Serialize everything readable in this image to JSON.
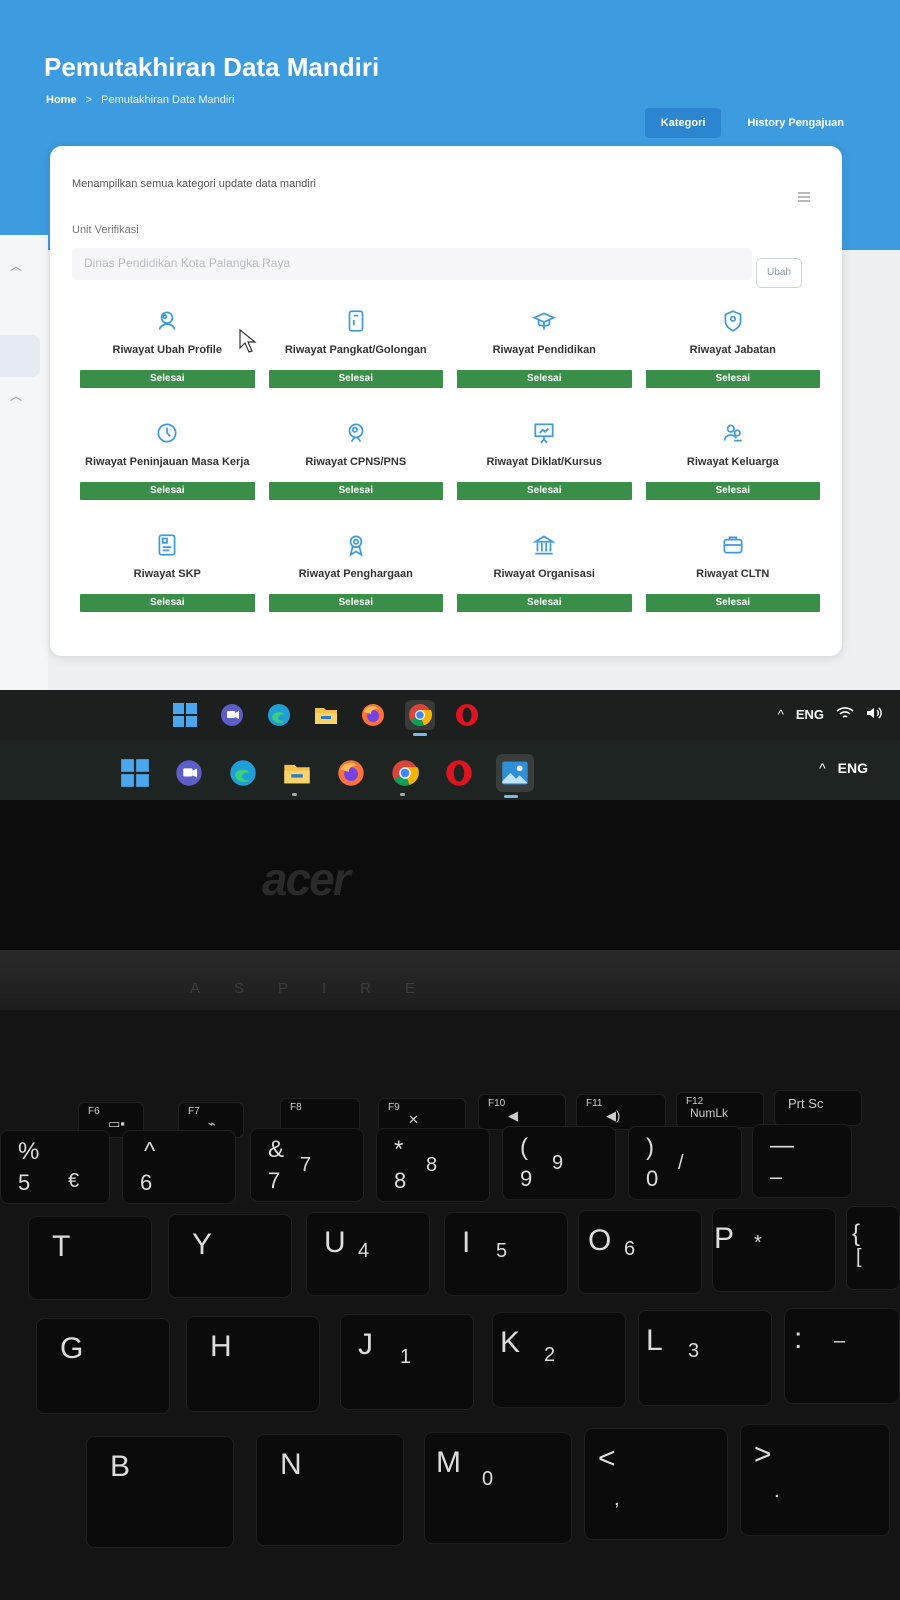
{
  "app": {
    "title": "Pemutakhiran Data Mandiri",
    "breadcrumb": {
      "home": "Home",
      "separator": ">",
      "current": "Pemutakhiran Data Mandiri"
    },
    "tabs": [
      {
        "label": "Kategori",
        "active": true
      },
      {
        "label": "History Pengajuan",
        "active": false
      }
    ],
    "accent_color": "#3d9be0",
    "status_color": "#3a8f48"
  },
  "card": {
    "description": "Menampilkan semua kategori update data mandiri",
    "unit_label": "Unit Verifikasi",
    "unit_value": "Dinas Pendidikan Kota Palangka Raya",
    "ubah_label": "Ubah"
  },
  "categories": [
    {
      "name": "Riwayat Ubah Profile",
      "status": "Selesai",
      "icon": "user-edit-icon"
    },
    {
      "name": "Riwayat Pangkat/Golongan",
      "status": "Selesai",
      "icon": "id-badge-icon"
    },
    {
      "name": "Riwayat Pendidikan",
      "status": "Selesai",
      "icon": "graduation-cap-icon"
    },
    {
      "name": "Riwayat Jabatan",
      "status": "Selesai",
      "icon": "shield-icon"
    },
    {
      "name": "Riwayat Peninjauan Masa Kerja",
      "status": "Selesai",
      "icon": "clock-icon"
    },
    {
      "name": "Riwayat CPNS/PNS",
      "status": "Selesai",
      "icon": "user-badge-icon"
    },
    {
      "name": "Riwayat Diklat/Kursus",
      "status": "Selesai",
      "icon": "presentation-icon"
    },
    {
      "name": "Riwayat Keluarga",
      "status": "Selesai",
      "icon": "family-icon"
    },
    {
      "name": "Riwayat SKP",
      "status": "Selesai",
      "icon": "document-icon"
    },
    {
      "name": "Riwayat Penghargaan",
      "status": "Selesai",
      "icon": "award-icon"
    },
    {
      "name": "Riwayat Organisasi",
      "status": "Selesai",
      "icon": "organization-icon"
    },
    {
      "name": "Riwayat CLTN",
      "status": "Selesai",
      "icon": "briefcase-icon"
    }
  ],
  "taskbar": {
    "icons": [
      "windows-start-icon",
      "teams-chat-icon",
      "edge-icon",
      "file-explorer-icon",
      "firefox-icon",
      "chrome-icon",
      "opera-icon"
    ],
    "language": "ENG",
    "tray_arrow": "^"
  },
  "taskbar_secondary": {
    "icons": [
      "windows-start-icon",
      "teams-chat-icon",
      "edge-icon",
      "file-explorer-icon",
      "firefox-icon",
      "chrome-icon",
      "opera-icon",
      "photos-icon"
    ],
    "language": "ENG",
    "tray_arrow": "^"
  },
  "laptop": {
    "brand": "acer",
    "model": "ASPIRE",
    "fkeys": [
      {
        "label": "F6"
      },
      {
        "label": "F7"
      },
      {
        "label": "F8"
      },
      {
        "label": "F9"
      },
      {
        "label": "F10"
      },
      {
        "label": "F11"
      },
      {
        "label": "F12",
        "extra": "NumLk"
      },
      {
        "label": "Prt Sc"
      }
    ],
    "number_row": [
      {
        "top": "%",
        "bottom": "5",
        "alt": "€"
      },
      {
        "top": "^",
        "bottom": "6"
      },
      {
        "top": "&",
        "bottom": "7",
        "alt": "7"
      },
      {
        "top": "*",
        "bottom": "8",
        "alt": "8"
      },
      {
        "top": "(",
        "bottom": "9",
        "alt": "9"
      },
      {
        "top": ")",
        "bottom": "0",
        "alt": "/"
      },
      {
        "top": "—",
        "bottom": "–"
      }
    ],
    "row_t": [
      {
        "main": "T"
      },
      {
        "main": "Y"
      },
      {
        "main": "U",
        "sub": "4"
      },
      {
        "main": "I",
        "sub": "5"
      },
      {
        "main": "O",
        "sub": "6"
      },
      {
        "main": "P",
        "sub": "*"
      },
      {
        "main": "{",
        "sub": "["
      }
    ],
    "row_g": [
      {
        "main": "G"
      },
      {
        "main": "H"
      },
      {
        "main": "J",
        "sub": "1"
      },
      {
        "main": "K",
        "sub": "2"
      },
      {
        "main": "L",
        "sub": "3"
      },
      {
        "main": ":",
        "sub": "–"
      }
    ],
    "row_b": [
      {
        "main": "B"
      },
      {
        "main": "N"
      },
      {
        "main": "M",
        "sub": "0"
      },
      {
        "main": "<",
        "sub": ","
      },
      {
        "main": ">",
        "sub": "."
      }
    ]
  }
}
